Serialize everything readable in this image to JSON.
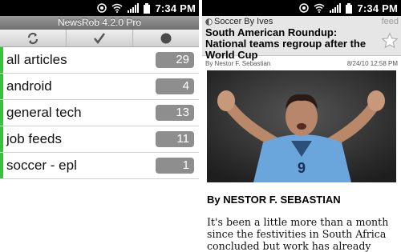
{
  "status": {
    "left_time": "7:34 PM",
    "right_time": "7:34 PM"
  },
  "newsrob": {
    "title": "NewsRob 4.2.0 Pro",
    "toolbar": {
      "refresh_icon": "refresh-icon",
      "mark_read_icon": "checkmark-icon",
      "toggle_icon": "circle-icon"
    },
    "rows": [
      {
        "label": "all articles",
        "count": "29",
        "bar_color": "#37c23a"
      },
      {
        "label": "android",
        "count": "4",
        "bar_color": "#37c23a"
      },
      {
        "label": "general tech",
        "count": "13",
        "bar_color": "#37c23a"
      },
      {
        "label": "job feeds",
        "count": "11",
        "bar_color": "#37c23a"
      },
      {
        "label": "soccer - epl",
        "count": "1",
        "bar_color": "#37c23a"
      }
    ]
  },
  "article": {
    "feed_name": "Soccer By Ives",
    "feed_tag": "feed",
    "headline": "South American Roundup: National teams regroup after the World Cup",
    "author_meta": "By Nestor F. Sebastian",
    "date": "8/24/10 12:58 PM",
    "byline": "By NESTOR F. SEBASTIAN",
    "body": "It's been a little more than a month since the festivities in South Africa concluded but work has already begun for many"
  },
  "colors": {
    "unread_bar": "#37c23a",
    "count_badge": "#8e8e8e"
  }
}
